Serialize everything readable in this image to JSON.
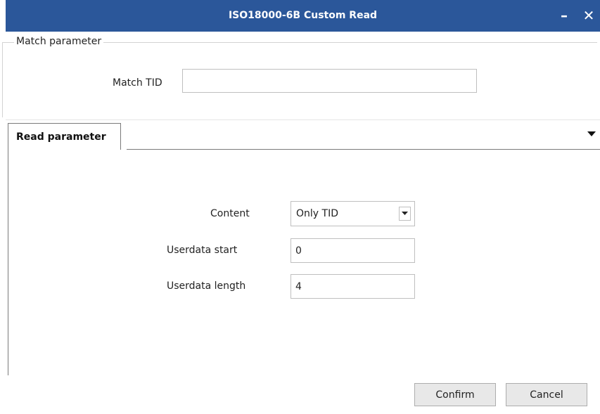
{
  "window": {
    "title": "ISO18000-6B Custom Read",
    "minimize_glyph": "–",
    "close_glyph": "✕",
    "accent": "#2b579a"
  },
  "match_group": {
    "legend": "Match parameter",
    "match_tid_label": "Match TID",
    "match_tid_value": ""
  },
  "read_tab": {
    "label": "Read parameter",
    "dropdown_icon": "triangle-down-icon"
  },
  "read_fields": {
    "content_label": "Content",
    "content_selected": "Only TID",
    "userdata_start_label": "Userdata start",
    "userdata_start_value": "0",
    "userdata_length_label": "Userdata length",
    "userdata_length_value": "4"
  },
  "buttons": {
    "confirm": "Confirm",
    "cancel": "Cancel"
  }
}
